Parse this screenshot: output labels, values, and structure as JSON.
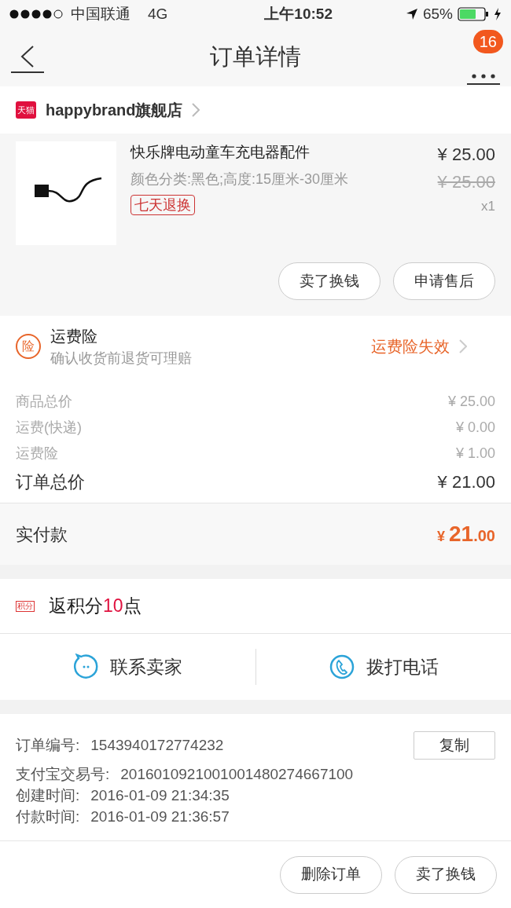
{
  "status_bar": {
    "carrier": "中国联通",
    "network": "4G",
    "time": "上午10:52",
    "battery": "65%"
  },
  "nav": {
    "title": "订单详情",
    "badge": "16"
  },
  "shop": {
    "badge": "天猫",
    "name": "happybrand旗舰店"
  },
  "product": {
    "title": "快乐牌电动童车充电器配件",
    "spec": "颜色分类:黑色;高度:15厘米-30厘米",
    "tag": "七天退换",
    "price": "¥ 25.00",
    "original_price": "¥ 25.00",
    "quantity": "x1",
    "actions": [
      "卖了换钱",
      "申请售后"
    ]
  },
  "insurance": {
    "icon": "险",
    "title": "运费险",
    "subtitle": "确认收货前退货可理赔",
    "status": "运费险失效"
  },
  "price_rows": [
    {
      "label": "商品总价",
      "value": "¥ 25.00",
      "kind": "minor"
    },
    {
      "label": "运费(快递)",
      "value": "¥ 0.00",
      "kind": "minor"
    },
    {
      "label": "运费险",
      "value": "¥ 1.00",
      "kind": "minor"
    },
    {
      "label": "订单总价",
      "value": "¥ 21.00",
      "kind": "total"
    }
  ],
  "paid": {
    "label": "实付款",
    "currency": "¥",
    "integer": "21",
    "decimal": ".00"
  },
  "points": {
    "badge": "积分",
    "prefix": "返积分",
    "value": "10",
    "suffix": "点"
  },
  "contacts": [
    {
      "label": "联系卖家",
      "kind": "chat"
    },
    {
      "label": "拨打电话",
      "kind": "phone"
    }
  ],
  "order_info": {
    "copy_button": "复制",
    "rows": [
      {
        "label": "订单编号:",
        "value": "1543940172774232"
      },
      {
        "label": "支付宝交易号:",
        "value": "2016010921001001480274667100"
      },
      {
        "label": "创建时间:",
        "value": "2016-01-09 21:34:35"
      },
      {
        "label": "付款时间:",
        "value": "2016-01-09 21:36:57"
      }
    ]
  },
  "bottom_actions": [
    "删除订单",
    "卖了换钱"
  ]
}
